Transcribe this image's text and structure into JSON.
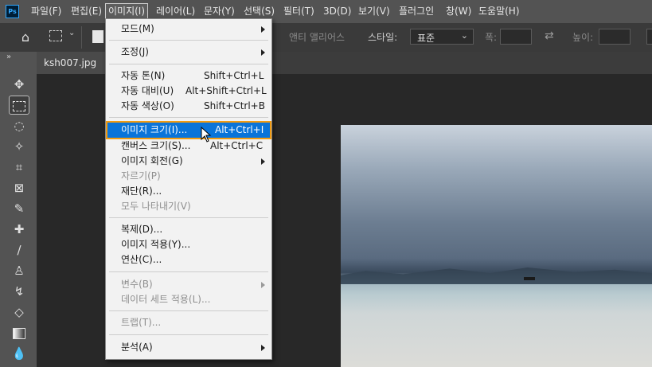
{
  "app": {
    "logo": "Ps"
  },
  "menubar": {
    "items": [
      {
        "label": "파일(F)"
      },
      {
        "label": "편집(E)"
      },
      {
        "label": "이미지(I)"
      },
      {
        "label": "레이어(L)"
      },
      {
        "label": "문자(Y)"
      },
      {
        "label": "선택(S)"
      },
      {
        "label": "필터(T)"
      },
      {
        "label": "3D(D)"
      },
      {
        "label": "보기(V)"
      },
      {
        "label": "플러그인"
      },
      {
        "label": "창(W)"
      },
      {
        "label": "도움말(H)"
      }
    ]
  },
  "options": {
    "antialias_label": "앤티 앨리어스",
    "style_label": "스타일:",
    "style_value": "표준",
    "width_label": "폭:",
    "height_label": "높이:"
  },
  "document": {
    "tab_label": "ksh007.jpg @"
  },
  "image_menu": {
    "items": [
      {
        "label": "모드(M)",
        "shortcut": "",
        "submenu": true,
        "disabled": false
      },
      {
        "label": "조정(J)",
        "shortcut": "",
        "submenu": true,
        "disabled": false
      },
      {
        "label": "자동 톤(N)",
        "shortcut": "Shift+Ctrl+L",
        "submenu": false,
        "disabled": false
      },
      {
        "label": "자동 대비(U)",
        "shortcut": "Alt+Shift+Ctrl+L",
        "submenu": false,
        "disabled": false
      },
      {
        "label": "자동 색상(O)",
        "shortcut": "Shift+Ctrl+B",
        "submenu": false,
        "disabled": false
      },
      {
        "label": "이미지 크기(I)...",
        "shortcut": "Alt+Ctrl+I",
        "submenu": false,
        "disabled": false,
        "highlighted": true
      },
      {
        "label": "캔버스 크기(S)...",
        "shortcut": "Alt+Ctrl+C",
        "submenu": false,
        "disabled": false
      },
      {
        "label": "이미지 회전(G)",
        "shortcut": "",
        "submenu": true,
        "disabled": false
      },
      {
        "label": "자르기(P)",
        "shortcut": "",
        "submenu": false,
        "disabled": true
      },
      {
        "label": "재단(R)...",
        "shortcut": "",
        "submenu": false,
        "disabled": false
      },
      {
        "label": "모두 나타내기(V)",
        "shortcut": "",
        "submenu": false,
        "disabled": true
      },
      {
        "label": "복제(D)...",
        "shortcut": "",
        "submenu": false,
        "disabled": false
      },
      {
        "label": "이미지 적용(Y)...",
        "shortcut": "",
        "submenu": false,
        "disabled": false
      },
      {
        "label": "연산(C)...",
        "shortcut": "",
        "submenu": false,
        "disabled": false
      },
      {
        "label": "변수(B)",
        "shortcut": "",
        "submenu": true,
        "disabled": true
      },
      {
        "label": "데이터 세트 적용(L)...",
        "shortcut": "",
        "submenu": false,
        "disabled": true
      },
      {
        "label": "트랩(T)...",
        "shortcut": "",
        "submenu": false,
        "disabled": true
      },
      {
        "label": "분석(A)",
        "shortcut": "",
        "submenu": true,
        "disabled": false
      }
    ]
  },
  "colors": {
    "highlight": "#0a74d9",
    "highlight_outline": "#f39c12",
    "brand": "#31a8ff"
  }
}
